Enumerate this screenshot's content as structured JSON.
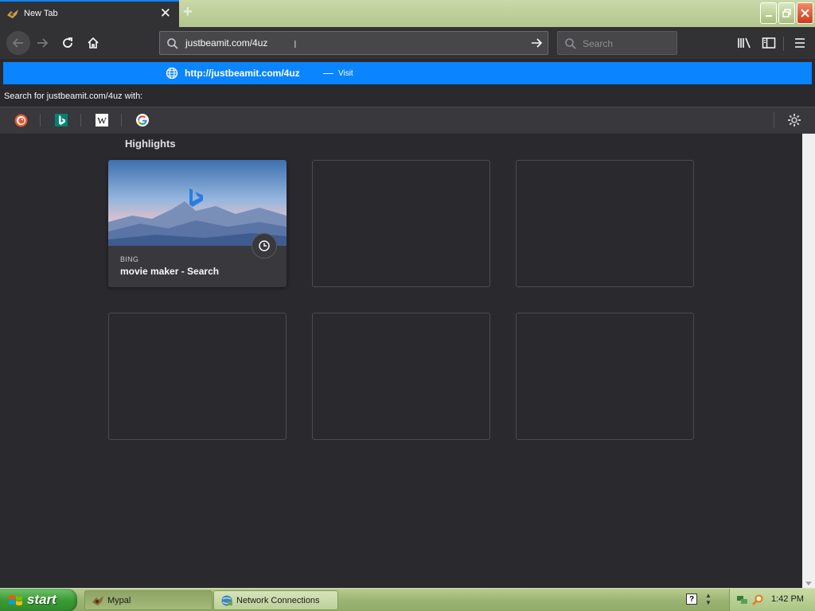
{
  "tab": {
    "title": "New Tab",
    "close": "✕",
    "new_tab": "+"
  },
  "window_buttons": {
    "minimize": "▬",
    "restore": "❐",
    "close": "✕"
  },
  "urlbar": {
    "value": "justbeamit.com/4uz"
  },
  "searchbar": {
    "placeholder": "Search"
  },
  "autocomplete": {
    "result_url": "http://justbeamit.com/4uz",
    "result_dash": "—",
    "result_action": "Visit",
    "search_for": "Search for justbeamit.com/4uz with:",
    "engines": [
      "DuckDuckGo",
      "Bing",
      "Wikipedia",
      "Google"
    ]
  },
  "highlights": {
    "heading": "Highlights",
    "cards": [
      {
        "source": "BING",
        "title": "movie maker - Search"
      }
    ]
  },
  "taskbar": {
    "start": "start",
    "buttons": [
      {
        "label": "Mypal"
      },
      {
        "label": "Network Connections"
      }
    ],
    "clock": "1:42 PM"
  },
  "colors": {
    "accent": "#0a84ff",
    "background": "#2a2a2e",
    "toolbar": "#323234"
  }
}
